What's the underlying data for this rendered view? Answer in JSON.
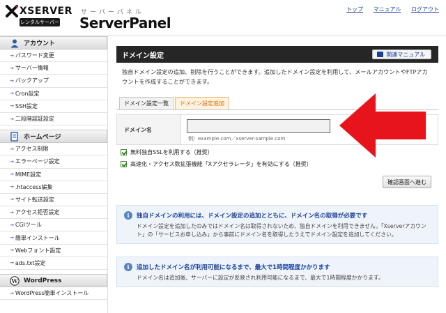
{
  "header": {
    "brand": "XSERVER",
    "badge": "レンタルサーバー",
    "kana": "サーバーパネル",
    "product": "ServerPanel",
    "links": [
      "トップ",
      "マニュアル",
      "ログアウト"
    ]
  },
  "sidebar": {
    "sections": [
      {
        "title": "アカウント",
        "items": [
          "パスワード変更",
          "サーバー情報",
          "バックアップ",
          "Cron設定",
          "SSH設定",
          "二段階認証設定"
        ]
      },
      {
        "title": "ホームページ",
        "items": [
          "アクセス制限",
          "エラーページ設定",
          "MIME設定",
          ".htaccess編集",
          "サイト転送設定",
          "アクセス拒否設定",
          "CGIツール",
          "簡単インストール",
          "Webフォント設定",
          "ads.txt設定"
        ]
      },
      {
        "title": "WordPress",
        "items": [
          "WordPress簡単インストール"
        ]
      }
    ]
  },
  "main": {
    "title": "ドメイン設定",
    "manual_button": "関連マニュアル",
    "description": "独自ドメイン設定の追加、削除を行うことができます。追加したドメイン設定を利用して、メールアカウントやFTPアカウントを作成することができます。",
    "tabs": [
      "ドメイン設定一覧",
      "ドメイン設定追加"
    ],
    "form": {
      "label": "ドメイン名",
      "input_value": "",
      "example": "例）example.com／xserver-sample.com"
    },
    "checkboxes": [
      "無料独自SSLを利用する（推奨）",
      "高速化・アクセス数拡張機能「Xアクセラレータ」を有効にする（推奨）"
    ],
    "confirm_button": "確認画面へ進む",
    "info1": {
      "title": "独自ドメインの利用には、ドメイン設定の追加とともに、ドメイン名の取得が必要です",
      "body": "ドメイン設定を追加したのみではドメイン名は取得されないため、独自ドメインを利用できません。「Xserverアカウント」の「サービスお申し込み」から事前にドメイン名を取得したうえでドメイン設定を追加してください。"
    },
    "info2": {
      "title": "追加したドメイン名が利用可能になるまで、最大で1時間程度かかります",
      "body": "ドメイン名は追加後、サーバーに設定が反映され利用可能になるまで、最大で1時間程度かかります。"
    }
  },
  "colors": {
    "accent_red": "#e8141b",
    "link_blue": "#1a3f9c",
    "tab_orange": "#e06a00"
  }
}
